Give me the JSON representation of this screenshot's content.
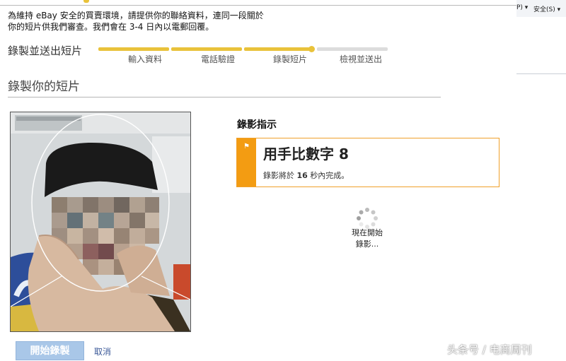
{
  "browser_toolbar": {
    "page_menu": "P) ▾",
    "security_menu": "安全(S) ▾"
  },
  "notice": {
    "line1": "為維持 eBay 安全的買賣環境，請提供你的聯絡資料，連同一段關於",
    "line2": "你的短片供我們審查。我們會在 3-4 日內以電郵回覆。"
  },
  "progress": {
    "title": "錄製並送出短片",
    "steps": [
      "輸入資料",
      "電話驗證",
      "錄製短片",
      "檢視並送出"
    ],
    "current_step": 3
  },
  "section_title": "錄製你的短片",
  "instructions": {
    "heading": "錄影指示",
    "gesture": "用手比數字 8",
    "countdown_prefix": "錄影將於",
    "countdown_value": "16",
    "countdown_suffix": "秒內完成。"
  },
  "loading": {
    "line1": "現在開始",
    "line2": "錄影..."
  },
  "actions": {
    "start_label": "開始錄製",
    "cancel_label": "取消"
  },
  "watermark": "头条号 / 电商周刊",
  "colors": {
    "accent_orange": "#f39c12",
    "progress_yellow": "#e9c23a",
    "button_blue": "#a9c7e8",
    "link_blue": "#3b5998"
  }
}
